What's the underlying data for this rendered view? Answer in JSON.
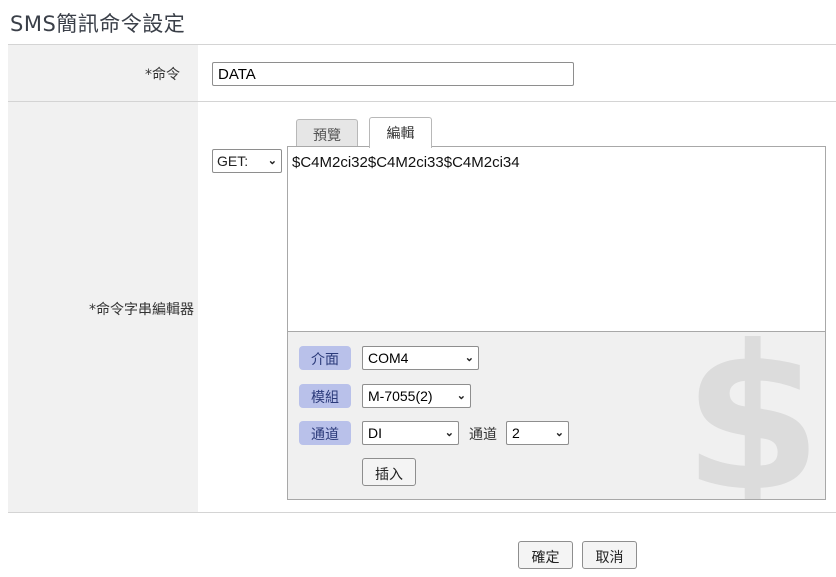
{
  "page": {
    "title": "SMS簡訊命令設定"
  },
  "command": {
    "label": "*命令",
    "value": "DATA"
  },
  "editor_row": {
    "label": "*命令字串編輯器",
    "tabs": {
      "preview": "預覽",
      "edit": "編輯"
    },
    "method": {
      "value": "GET:"
    },
    "content": "$C4M2ci32$C4M2ci33$C4M2ci34",
    "watermark": "$",
    "insert": {
      "interface_label": "介面",
      "interface_value": "COM4",
      "module_label": "模組",
      "module_value": "M-7055(2)",
      "channel_type_label": "通道",
      "channel_type_value": "DI",
      "channel_inline_label": "通道",
      "channel_value": "2",
      "insert_button": "插入"
    }
  },
  "footer": {
    "confirm": "確定",
    "cancel": "取消"
  },
  "colors": {
    "badge_bg": "#b9c1ea",
    "label_col_bg": "#f1f1f1",
    "panel_bg": "#f0f0f0"
  }
}
